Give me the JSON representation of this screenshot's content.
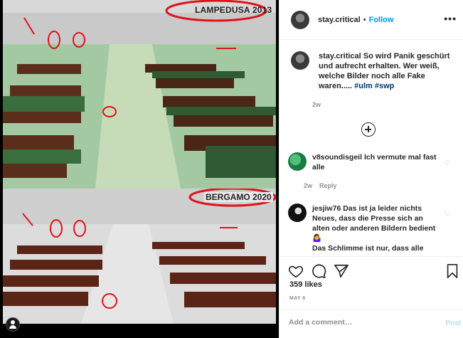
{
  "post": {
    "username": "stay.critical",
    "follow_label": "Follow",
    "separator": "•",
    "more_label": "•••",
    "caption_text": "So wird Panik geschürt und aufrecht erhalten. Wer weiß, welche Bilder noch alle Fake waren.....",
    "hashtags": [
      "#ulm",
      "#swp"
    ],
    "caption_time": "2w",
    "likes": "359 likes",
    "date": "MAY 6"
  },
  "media": {
    "top_label": "LAMPEDUSA 2013",
    "bottom_label": "BERGAMO 2020"
  },
  "comments": [
    {
      "username": "v8soundisgeil",
      "text": "Ich vermute mal fast alle",
      "time": "2w",
      "reply_label": "Reply"
    },
    {
      "username": "jesjiw76",
      "text": "Das ist ja leider nichts Neues, dass die Presse sich an alten oder anderen Bildern bedient🤷‍♀️",
      "text2": "Das Schlimme ist nur, dass alle"
    }
  ],
  "add_comment": {
    "placeholder": "Add a comment…",
    "post_label": "Post"
  },
  "colors": {
    "follow_blue": "#0095f6",
    "hashtag": "#00376b",
    "muted": "#8e8e8e",
    "border": "#efefef"
  },
  "icons": [
    "more-icon",
    "load-more-icon",
    "heart-icon",
    "comment-icon",
    "share-icon",
    "bookmark-icon",
    "user-tag-icon"
  ]
}
